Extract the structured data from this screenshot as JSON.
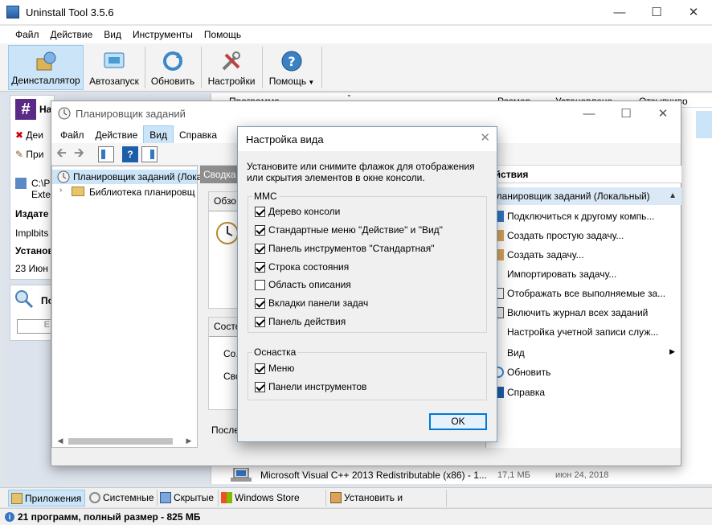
{
  "ut": {
    "title": "Uninstall Tool 3.5.6",
    "menu": [
      "Файл",
      "Действие",
      "Вид",
      "Инструменты",
      "Помощь"
    ],
    "toolbar": {
      "uninstaller": "Деинсталлятор",
      "autorun": "Автозапуск",
      "update": "Обновить",
      "settings": "Настройки",
      "help": "Помощь"
    },
    "list_headers": {
      "program": "Программа",
      "size": "Размер",
      "installed": "Установлено",
      "rating": "Отзывчиво"
    },
    "visible_row": {
      "name": "Microsoft Visual C++ 2013 Redistributable (x86) - 1...",
      "size": "17,1 МБ",
      "date": "июн 24, 2018"
    },
    "left_partial": {
      "title_fragment": "На",
      "action1": "Деи",
      "action2": "При",
      "path1": "C:\\P",
      "path2": "Exte",
      "publisher_label": "Издате",
      "publisher_value": "Implbits",
      "installed_label": "Установ",
      "installed_value": "23 Июн",
      "search_title": "По",
      "search_placeholder": "Е"
    },
    "bottom_tabs": [
      "Приложения",
      "Системные",
      "Скрытые",
      "Windows Store Apps",
      "Установить и следить"
    ],
    "status": {
      "prefix": "21 программ, полный размер - ",
      "size": "825 МБ"
    }
  },
  "ts": {
    "title": "Планировщик заданий",
    "menu": [
      "Файл",
      "Действие",
      "Вид",
      "Справка"
    ],
    "tree": {
      "root": "Планировщик заданий (Локал",
      "child": "Библиотека планировщ"
    },
    "center": {
      "summary_tab": "Сводка",
      "overview": "Обзо",
      "status": "Состо",
      "field1": "Со...",
      "field2": "Сво",
      "last": "После"
    },
    "actions": {
      "header": "ействия",
      "section": "Планировщик заданий (Локальный)",
      "items": [
        "Подключиться к другому компь...",
        "Создать простую задачу...",
        "Создать задачу...",
        "Импортировать задачу...",
        "Отображать все выполняемые за...",
        "Включить журнал всех заданий",
        "Настройка учетной записи служ...",
        "Вид",
        "Обновить",
        "Справка"
      ]
    }
  },
  "dialog": {
    "title": "Настройка вида",
    "description": "Установите или снимите флажок для отображения или скрытия элементов в окне консоли.",
    "mmc_label": "MMC",
    "mmc_options": [
      {
        "label": "Дерево консоли",
        "checked": true
      },
      {
        "label": "Стандартные меню \"Действие\" и \"Вид\"",
        "checked": true
      },
      {
        "label": "Панель инструментов \"Стандартная\"",
        "checked": true
      },
      {
        "label": "Строка состояния",
        "checked": true
      },
      {
        "label": "Область описания",
        "checked": false
      },
      {
        "label": "Вкладки панели задач",
        "checked": true
      },
      {
        "label": "Панель действия",
        "checked": true
      }
    ],
    "snapin_label": "Оснастка",
    "snapin_options": [
      {
        "label": "Меню",
        "checked": true
      },
      {
        "label": "Панели инструментов",
        "checked": true
      }
    ],
    "ok": "OK"
  },
  "colors": {
    "accent": "#0078d7",
    "selection": "#cce4f7",
    "purple_logo": "#5b2a86"
  }
}
